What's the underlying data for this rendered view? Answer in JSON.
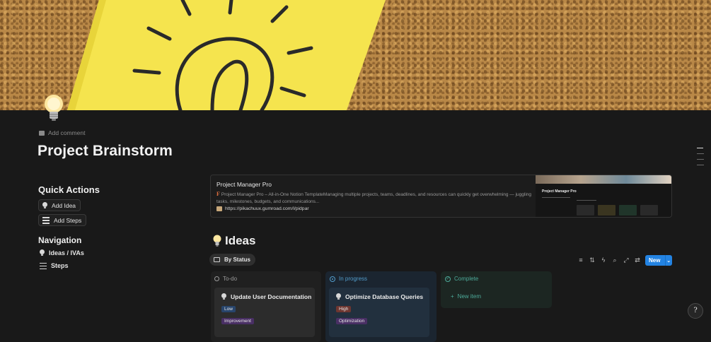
{
  "page": {
    "comment_label": "Add comment",
    "title": "Project Brainstorm"
  },
  "quick_actions": {
    "heading": "Quick Actions",
    "buttons": [
      {
        "label": "Add Idea",
        "icon": "lightbulb-icon"
      },
      {
        "label": "Add Steps",
        "icon": "checklist-icon"
      }
    ]
  },
  "navigation": {
    "heading": "Navigation",
    "items": [
      {
        "label": "Ideas / IVAs",
        "icon": "lightbulb-icon"
      },
      {
        "label": "Steps",
        "icon": "checklist-icon"
      }
    ]
  },
  "bookmark": {
    "title": "Project Manager Pro",
    "description": "Project Manager Pro – All-in-One Notion TemplateManaging multiple projects, teams, deadlines, and resources can quickly get overwhelming — juggling tasks, milestones, budgets, and communications...",
    "favicon_letter": "F",
    "url": "https://pikachuux.gumroad.com/l/pidpar",
    "thumb_title": "Project Manager Pro"
  },
  "ideas": {
    "heading": "Ideas",
    "view_tab": "By Status",
    "new_label": "New",
    "columns": [
      {
        "name": "To-do",
        "color": "#9b9b9b"
      },
      {
        "name": "In progress",
        "color": "#529cca"
      },
      {
        "name": "Complete",
        "color": "#4dab9a"
      }
    ],
    "cards": [
      {
        "title": "Update User Documentation",
        "priority": "Low",
        "category": "Improvement"
      },
      {
        "title": "Optimize Database Queries",
        "priority": "High",
        "category": "Optimization"
      }
    ],
    "new_item_label": "New item"
  },
  "help_label": "?",
  "colors": {
    "accent": "#2383e2",
    "background": "#191919",
    "tag_low": "#28456c",
    "tag_high": "#6e3630",
    "tag_category": "#492f64"
  }
}
